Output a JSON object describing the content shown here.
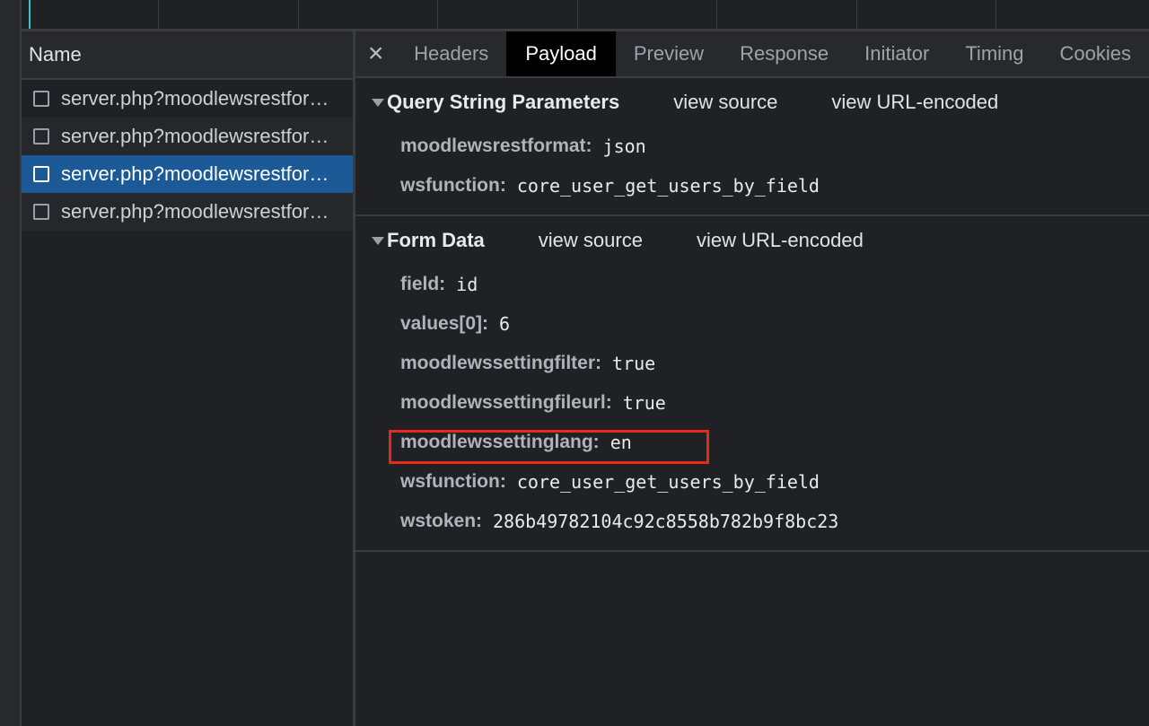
{
  "name_panel": {
    "header": "Name",
    "requests": [
      {
        "label": "server.php?moodlewsrestformat=json",
        "selected": false
      },
      {
        "label": "server.php?moodlewsrestformat=json",
        "selected": false
      },
      {
        "label": "server.php?moodlewsrestformat=json",
        "selected": true
      },
      {
        "label": "server.php?moodlewsrestformat=json",
        "selected": false
      }
    ]
  },
  "tabs": [
    "Headers",
    "Payload",
    "Preview",
    "Response",
    "Initiator",
    "Timing",
    "Cookies"
  ],
  "active_tab": "Payload",
  "close_icon": "×",
  "query_section": {
    "title": "Query String Parameters",
    "view_source": "view source",
    "view_encoded": "view URL-encoded",
    "params": [
      {
        "key": "moodlewsrestformat:",
        "value": "json"
      },
      {
        "key": "wsfunction:",
        "value": "core_user_get_users_by_field"
      }
    ]
  },
  "form_section": {
    "title": "Form Data",
    "view_source": "view source",
    "view_encoded": "view URL-encoded",
    "params": [
      {
        "key": "field:",
        "value": "id"
      },
      {
        "key": "values[0]:",
        "value": "6"
      },
      {
        "key": "moodlewssettingfilter:",
        "value": "true"
      },
      {
        "key": "moodlewssettingfileurl:",
        "value": "true"
      },
      {
        "key": "moodlewssettinglang:",
        "value": "en"
      },
      {
        "key": "wsfunction:",
        "value": "core_user_get_users_by_field"
      },
      {
        "key": "wstoken:",
        "value": "286b49782104c92c8558b782b9f8bc23"
      }
    ]
  },
  "colors": {
    "selected_row": "#1c5a97",
    "highlight_border": "#e8291c",
    "background": "#202124"
  }
}
